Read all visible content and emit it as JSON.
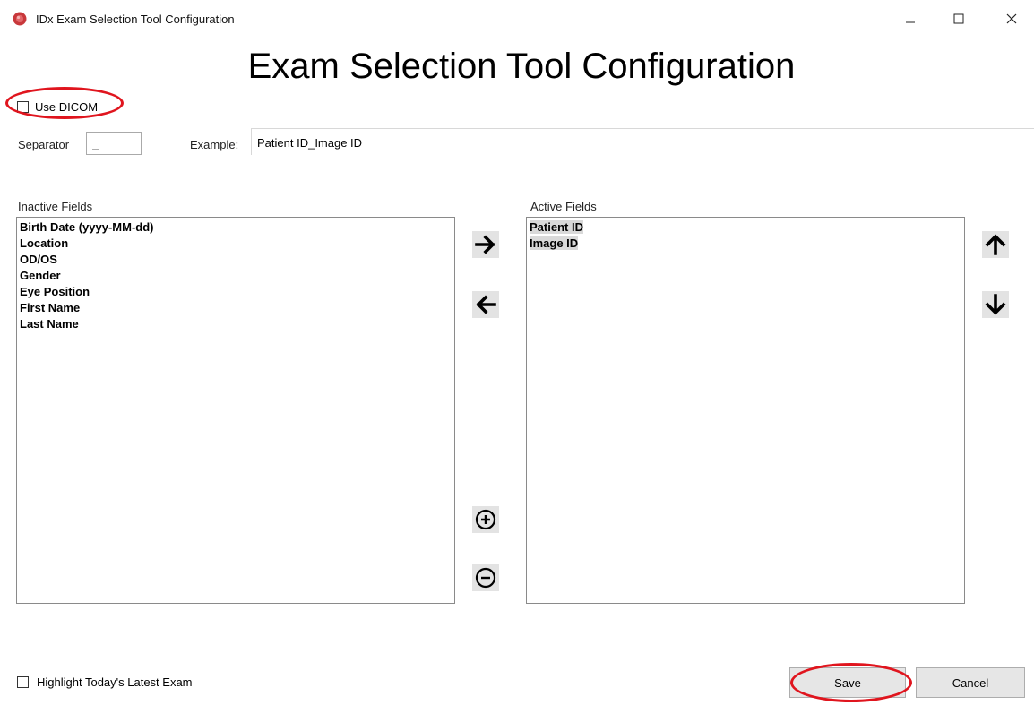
{
  "window": {
    "title": "IDx Exam Selection Tool Configuration",
    "controls": {
      "minimize": "–",
      "maximize": "☐",
      "close": "✕"
    }
  },
  "header": {
    "title": "Exam Selection Tool Configuration"
  },
  "options": {
    "use_dicom_label": "Use DICOM",
    "use_dicom_checked": false,
    "highlight_label": "Highlight Today's Latest Exam",
    "highlight_checked": false
  },
  "separator": {
    "label": "Separator",
    "value": "_"
  },
  "example": {
    "label": "Example:",
    "value": "Patient ID_Image ID"
  },
  "inactive_fields": {
    "label": "Inactive Fields",
    "items": [
      "Birth Date (yyyy-MM-dd)",
      "Location",
      "OD/OS",
      "Gender",
      "Eye Position",
      "First Name",
      "Last Name"
    ]
  },
  "active_fields": {
    "label": "Active Fields",
    "items": [
      "Patient ID",
      "Image ID"
    ]
  },
  "icons": {
    "move_right": "arrow-right-icon",
    "move_left": "arrow-left-icon",
    "add": "plus-circle-icon",
    "remove": "minus-circle-icon",
    "move_up": "arrow-up-icon",
    "move_down": "arrow-down-icon"
  },
  "footer": {
    "save_label": "Save",
    "cancel_label": "Cancel"
  },
  "colors": {
    "annotation": "#e0151e",
    "app_icon": "#c8383b"
  }
}
